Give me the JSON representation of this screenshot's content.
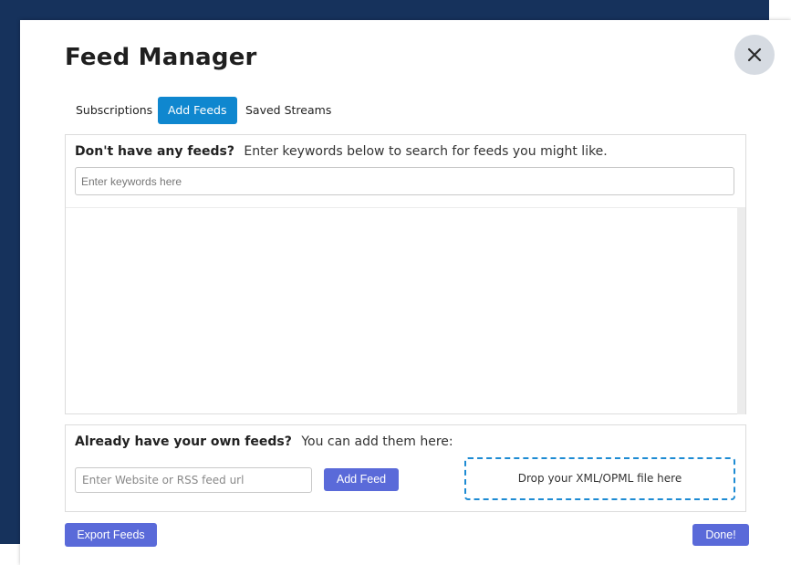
{
  "dialog": {
    "title": "Feed Manager",
    "close_icon": "close-icon"
  },
  "tabs": [
    {
      "label": "Subscriptions",
      "active": false
    },
    {
      "label": "Add Feeds",
      "active": true
    },
    {
      "label": "Saved Streams",
      "active": false
    }
  ],
  "search_section": {
    "heading": "Don't have any feeds?",
    "description": "Enter keywords below to search for feeds you might like.",
    "input_value": "",
    "input_placeholder": "Enter keywords here"
  },
  "own_feeds_section": {
    "heading": "Already have your own feeds?",
    "description": "You can add them here:",
    "input_value": "",
    "input_placeholder": "Enter Website or RSS feed url",
    "add_button_label": "Add Feed",
    "drop_zone_text": "Drop your XML/OPML file here"
  },
  "footer": {
    "export_label": "Export Feeds",
    "done_label": "Done!"
  },
  "colors": {
    "background_navy": "#16325c",
    "active_tab": "#0f87cf",
    "button": "#5a6ad9",
    "drop_zone_border": "#1d8bd3"
  }
}
